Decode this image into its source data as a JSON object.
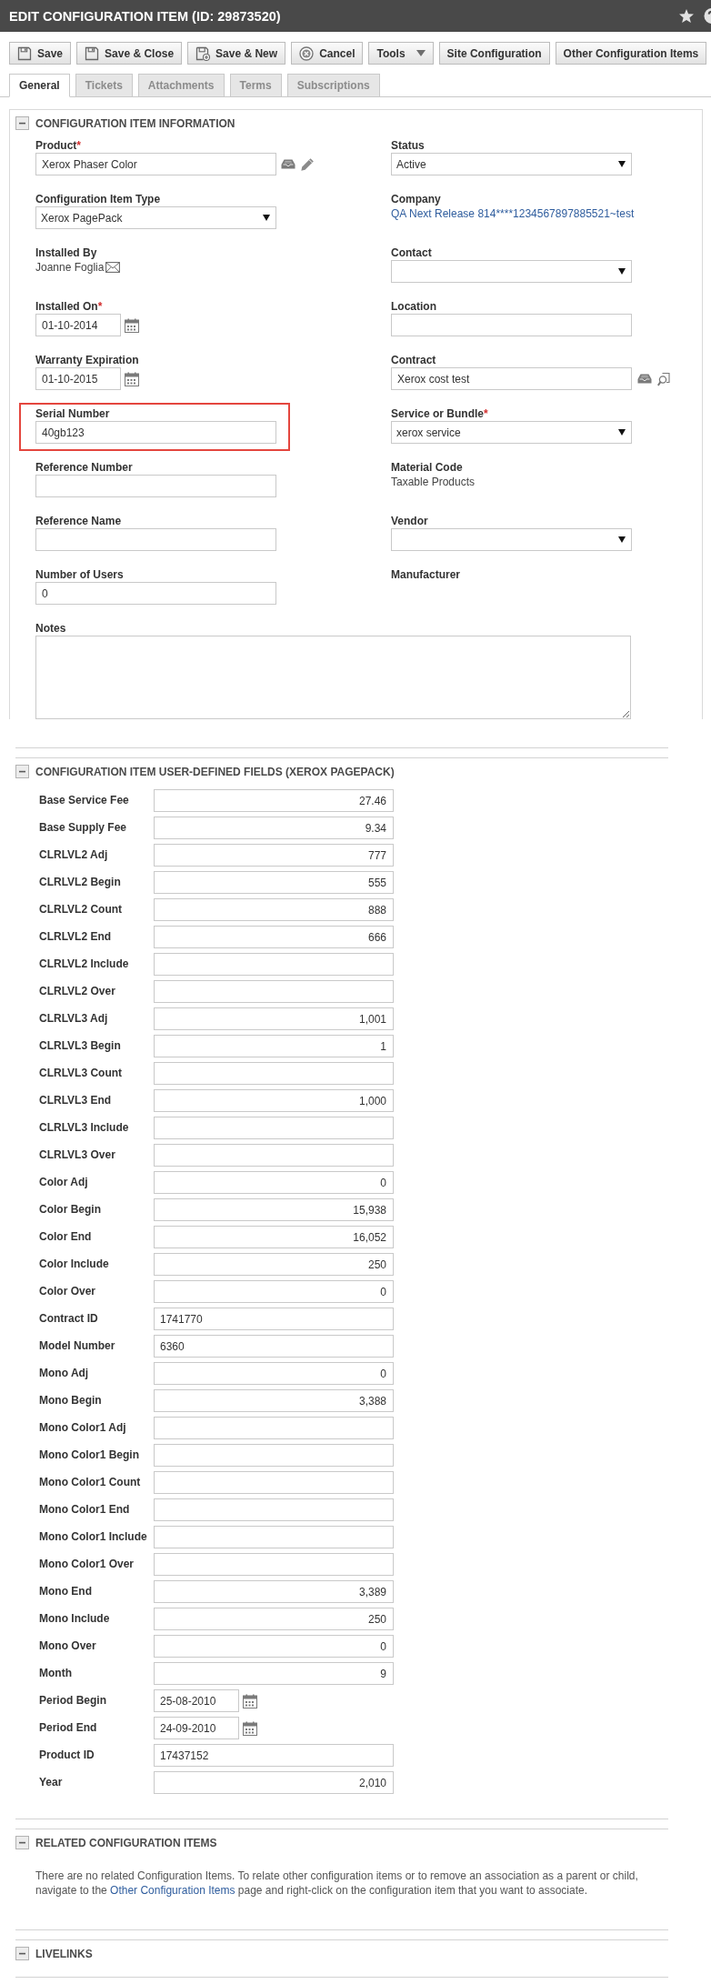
{
  "header": {
    "title": "EDIT CONFIGURATION ITEM (ID: 29873520)"
  },
  "toolbar": [
    {
      "label": "Save",
      "kind": "save"
    },
    {
      "label": "Save & Close",
      "kind": "save"
    },
    {
      "label": "Save & New",
      "kind": "save_new"
    },
    {
      "label": "Cancel",
      "kind": "cancel"
    },
    {
      "label": "Tools",
      "kind": "menu"
    },
    {
      "label": "Site Configuration",
      "kind": "plain"
    },
    {
      "label": "Other Configuration Items",
      "kind": "plain"
    }
  ],
  "tabs": [
    {
      "label": "General",
      "selected": true
    },
    {
      "label": "Tickets",
      "selected": false
    },
    {
      "label": "Attachments",
      "selected": false
    },
    {
      "label": "Terms",
      "selected": false
    },
    {
      "label": "Subscriptions",
      "selected": false
    }
  ],
  "information": {
    "title": "CONFIGURATION ITEM INFORMATION",
    "expanded": true,
    "left": [
      {
        "label": "Product",
        "required_mark": "*",
        "kind": "lookup_edit",
        "value": "Xerox Phaser Color",
        "highlighted": false
      },
      {
        "label": "Configuration Item Type",
        "kind": "select",
        "value": "Xerox PagePack",
        "highlighted": false
      },
      {
        "label": "Installed By",
        "kind": "person",
        "value": "Joanne Foglia",
        "highlighted": false
      },
      {
        "label": "Installed On",
        "required_mark": "*",
        "kind": "date",
        "value": "01-10-2014",
        "highlighted": false
      },
      {
        "label": "Warranty Expiration",
        "kind": "date",
        "value": "01-10-2015",
        "highlighted": false
      },
      {
        "label": "Serial Number",
        "kind": "text",
        "value": "40gb123",
        "highlighted": true
      },
      {
        "label": "Reference Number",
        "kind": "text",
        "highlighted": false
      },
      {
        "label": "Reference Name",
        "kind": "text",
        "highlighted": false
      },
      {
        "label": "Number of Users",
        "kind": "text",
        "value": "0",
        "highlighted": false
      }
    ],
    "right": [
      {
        "label": "Status",
        "kind": "select",
        "value": "Active",
        "highlighted": false
      },
      {
        "label": "Company",
        "kind": "link",
        "value": "QA Next Release 814****1234567897885521~test",
        "highlighted": false
      },
      {
        "label": "Contact",
        "kind": "select",
        "highlighted": false
      },
      {
        "label": "Location",
        "kind": "text",
        "highlighted": false
      },
      {
        "label": "Contract",
        "kind": "lookup_search",
        "value": "Xerox cost test",
        "highlighted": false
      },
      {
        "label": "Service or Bundle",
        "required_mark": "*",
        "kind": "select",
        "value": "xerox service",
        "highlighted": false
      },
      {
        "label": "Material Code",
        "kind": "static",
        "value": "Taxable Products",
        "highlighted": false
      },
      {
        "label": "Vendor",
        "kind": "select",
        "highlighted": false
      },
      {
        "label": "Manufacturer",
        "kind": "label",
        "highlighted": false
      }
    ],
    "notes": {
      "label": "Notes"
    }
  },
  "user_defined_fields": {
    "title": "CONFIGURATION ITEM USER-DEFINED FIELDS (XEROX PAGEPACK)",
    "expanded": true,
    "fields": [
      {
        "label": "Base Service Fee",
        "kind": "number",
        "value": "27.46"
      },
      {
        "label": "Base Supply Fee",
        "kind": "number",
        "value": "9.34"
      },
      {
        "label": "CLRLVL2 Adj",
        "kind": "number",
        "value": "777"
      },
      {
        "label": "CLRLVL2 Begin",
        "kind": "number",
        "value": "555"
      },
      {
        "label": "CLRLVL2 Count",
        "kind": "number",
        "value": "888"
      },
      {
        "label": "CLRLVL2 End",
        "kind": "number",
        "value": "666"
      },
      {
        "label": "CLRLVL2 Include",
        "kind": "number"
      },
      {
        "label": "CLRLVL2 Over",
        "kind": "number"
      },
      {
        "label": "CLRLVL3 Adj",
        "kind": "number",
        "value": "1,001"
      },
      {
        "label": "CLRLVL3 Begin",
        "kind": "number",
        "value": "1"
      },
      {
        "label": "CLRLVL3 Count",
        "kind": "number"
      },
      {
        "label": "CLRLVL3 End",
        "kind": "number",
        "value": "1,000"
      },
      {
        "label": "CLRLVL3 Include",
        "kind": "number"
      },
      {
        "label": "CLRLVL3 Over",
        "kind": "number"
      },
      {
        "label": "Color Adj",
        "kind": "number",
        "value": "0"
      },
      {
        "label": "Color Begin",
        "kind": "number",
        "value": "15,938"
      },
      {
        "label": "Color End",
        "kind": "number",
        "value": "16,052"
      },
      {
        "label": "Color Include",
        "kind": "number",
        "value": "250"
      },
      {
        "label": "Color Over",
        "kind": "number",
        "value": "0"
      },
      {
        "label": "Contract ID",
        "kind": "text",
        "value": "1741770"
      },
      {
        "label": "Model Number",
        "kind": "text",
        "value": "6360"
      },
      {
        "label": "Mono Adj",
        "kind": "number",
        "value": "0"
      },
      {
        "label": "Mono Begin",
        "kind": "number",
        "value": "3,388"
      },
      {
        "label": "Mono Color1 Adj",
        "kind": "number"
      },
      {
        "label": "Mono Color1 Begin",
        "kind": "number"
      },
      {
        "label": "Mono Color1 Count",
        "kind": "number"
      },
      {
        "label": "Mono Color1 End",
        "kind": "number"
      },
      {
        "label": "Mono Color1 Include",
        "kind": "number"
      },
      {
        "label": "Mono Color1 Over",
        "kind": "number"
      },
      {
        "label": "Mono End",
        "kind": "number",
        "value": "3,389"
      },
      {
        "label": "Mono Include",
        "kind": "number",
        "value": "250"
      },
      {
        "label": "Mono Over",
        "kind": "number",
        "value": "0"
      },
      {
        "label": "Month",
        "kind": "number",
        "value": "9"
      },
      {
        "label": "Period Begin",
        "kind": "date",
        "value": "25-08-2010"
      },
      {
        "label": "Period End",
        "kind": "date",
        "value": "24-09-2010"
      },
      {
        "label": "Product ID",
        "kind": "text",
        "value": "17437152"
      },
      {
        "label": "Year",
        "kind": "number",
        "value": "2,010"
      }
    ]
  },
  "related_items": {
    "title": "RELATED CONFIGURATION ITEMS",
    "expanded": true,
    "message": {
      "before": "There are no related Configuration Items. To relate other configuration items or to remove an association as a parent or child, navigate to the",
      "link": "Other Configuration Items",
      "after": "page and right-click on the configuration item that you want to associate."
    }
  },
  "livelinks": {
    "title": "LIVELINKS",
    "expanded": true
  }
}
